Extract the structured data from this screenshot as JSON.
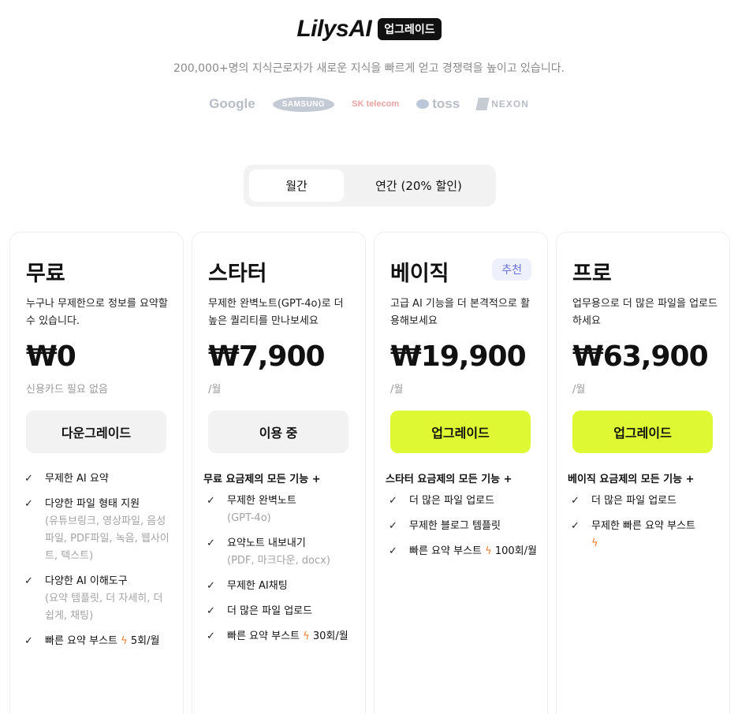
{
  "header": {
    "logo": "LilysAI",
    "badge": "업그레이드",
    "subtitle": "200,000+명의 지식근로자가 새로운 지식을 빠르게 얻고 경쟁력을 높이고 있습니다."
  },
  "partner_logos": [
    "Google",
    "SAMSUNG",
    "SK telecom",
    "toss",
    "NEXON"
  ],
  "billing_toggle": {
    "monthly": "월간",
    "yearly": "연간 (20% 할인)",
    "selected": "월간"
  },
  "colors": {
    "accent_lime": "#def933",
    "recommend_badge": "#6a72d8",
    "bolt": "#f07b2a"
  },
  "plans": [
    {
      "name": "무료",
      "desc": "누구나 무제한으로 정보를 요약할 수 있습니다.",
      "price": "₩0",
      "note": "신용카드 필요 없음",
      "cta": "다운그레이드",
      "features_header": "",
      "features": [
        {
          "text": "무제한 AI 요약",
          "sub": ""
        },
        {
          "text": "다양한 파일 형태 지원",
          "sub": "(유튜브링크, 영상파일, 음성파일, PDF파일, 녹음, 웹사이트, 텍스트)"
        },
        {
          "text": "다양한 AI 이해도구",
          "sub": "(요약 템플릿, 더 자세히, 더 쉽게, 채팅)"
        },
        {
          "text": "빠른 요약 부스트",
          "boost": "5회/월"
        }
      ]
    },
    {
      "name": "스타터",
      "desc": "무제한 완벽노트(GPT-4o)로 더 높은 퀄리티를 만나보세요",
      "price": "₩7,900",
      "note": "/월",
      "cta": "이용 중",
      "features_header": "무료 요금제의 모든 기능 +",
      "features": [
        {
          "text": "무제한 완벽노트",
          "sub": "(GPT-4o)"
        },
        {
          "text": "요약노트 내보내기",
          "sub": "(PDF, 마크다운, docx)"
        },
        {
          "text": "무제한 AI채팅",
          "sub": ""
        },
        {
          "text": "더 많은 파일 업로드",
          "sub": ""
        },
        {
          "text": "빠른 요약 부스트",
          "boost": "30회/월"
        }
      ]
    },
    {
      "name": "베이직",
      "badge": "추천",
      "desc": "고급 AI 기능을 더 본격적으로 활용해보세요",
      "price": "₩19,900",
      "note": "/월",
      "cta": "업그레이드",
      "features_header": "스타터 요금제의 모든 기능 +",
      "features": [
        {
          "text": "더 많은 파일 업로드",
          "sub": ""
        },
        {
          "text": "무제한 블로그 템플릿",
          "sub": ""
        },
        {
          "text": "빠른 요약 부스트",
          "boost": "100회/월"
        }
      ]
    },
    {
      "name": "프로",
      "desc": "업무용으로 더 많은 파일을 업로드하세요",
      "price": "₩63,900",
      "note": "/월",
      "cta": "업그레이드",
      "features_header": "베이직 요금제의 모든 기능 +",
      "features": [
        {
          "text": "더 많은 파일 업로드",
          "sub": ""
        },
        {
          "text": "무제한 빠른 요약 부스트",
          "boost": ""
        }
      ]
    }
  ]
}
